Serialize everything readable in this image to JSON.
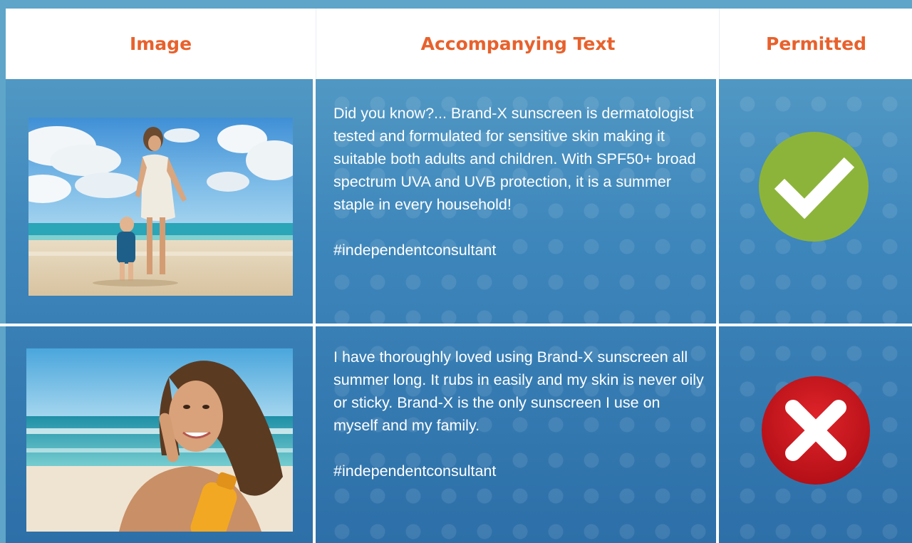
{
  "header": {
    "col_image": "Image",
    "col_text": "Accompanying Text",
    "col_permitted": "Permitted"
  },
  "rows": [
    {
      "image_alt": "Woman in white beach dress holding toddler's hand on sandy beach under blue sky",
      "text": "Did you know?... Brand-X sunscreen is dermatologist tested and formulated for sensitive skin making it suitable both adults and children. With SPF50+ broad spectrum UVA and UVB protection, it is a summer staple in every household!",
      "hashtag": "#independentconsultant",
      "permitted": true,
      "badge_icon": "check-icon"
    },
    {
      "image_alt": "Smiling woman applying sunscreen to her cheek at the beach holding an orange bottle",
      "text": "I have thoroughly loved using Brand-X sunscreen all summer long. It rubs in easily and my skin is never oily or sticky. Brand-X is the only sunscreen I use on myself and my family.",
      "hashtag": "#independentconsultant",
      "permitted": false,
      "badge_icon": "cross-icon"
    }
  ],
  "colors": {
    "header_text": "#e8612c",
    "check_green": "#8db43a",
    "cross_red": "#c4141c",
    "panel_blue": "#3d86bb"
  }
}
